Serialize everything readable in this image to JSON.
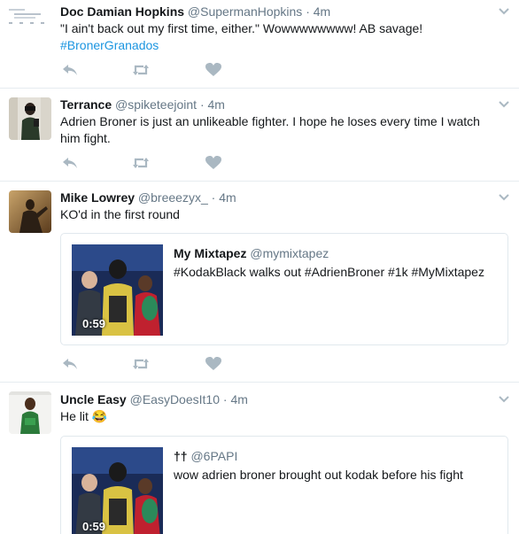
{
  "tweets": [
    {
      "name": "Doc Damian Hopkins",
      "handle": "@SupermanHopkins",
      "separator": "·",
      "time": "4m",
      "text": "\"I ain't back out my first time, either.\" Wowwwwwwww! AB savage!",
      "hashtag": "#BronerGranados"
    },
    {
      "name": "Terrance",
      "handle": "@spiketeejoint",
      "separator": "·",
      "time": "4m",
      "text": "Adrien Broner is just an unlikeable fighter. I hope he loses every time I watch him fight."
    },
    {
      "name": "Mike Lowrey",
      "handle": "@breeezyx_",
      "separator": "·",
      "time": "4m",
      "text": "KO'd in the first round",
      "quote": {
        "name": "My Mixtapez",
        "handle": "@mymixtapez",
        "text": "#KodakBlack walks out #AdrienBroner #1k #MyMixtapez",
        "duration": "0:59"
      }
    },
    {
      "name": "Uncle Easy",
      "handle": "@EasyDoesIt10",
      "separator": "·",
      "time": "4m",
      "text": "He lit 😂",
      "quote": {
        "name": "††",
        "handle": "@6PAPI",
        "text": "wow adrien broner brought out kodak before his fight",
        "duration": "0:59"
      }
    }
  ],
  "icons": {
    "reply": "reply-icon",
    "retweet": "retweet-icon",
    "like": "heart-icon",
    "caret": "chevron-down-icon"
  },
  "colors": {
    "icon": "#aab8c2",
    "hashtag": "#1b95e0",
    "secondary_text": "#657786",
    "border": "#e6ecf0"
  }
}
